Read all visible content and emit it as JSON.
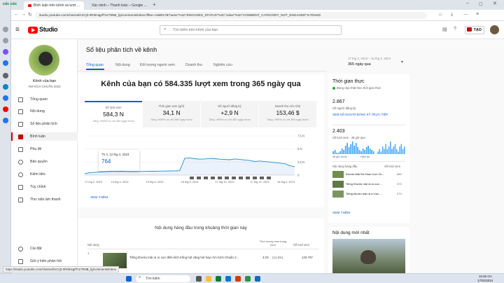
{
  "browser": {
    "brand": "cốc cốc",
    "tabs": [
      {
        "label": "Bình luận trên kênh và lượt ..."
      },
      {
        "label": "Xác minh – Thanh toán – Google ..."
      }
    ],
    "url": "studio.youtube.com/channel/UCrj3-0RI5HqpfTUr79NB_fg/comments/inbox?filter=%5B%7B\"name\"%3A\"ENGAGED_STATUS\"%2C\"value\"%3A\"COMMENT_CATEGORY_NOT_ENGAGED\"%7D%5D",
    "status_url": "https://studio.youtube.com/channel/UCrj3-0RI5HqpfTUr79NB_fg/comments/inbox"
  },
  "studio": {
    "logo": "Studio",
    "search_placeholder": "Tìm kiếm trên kênh của bạn",
    "create_label": "TẠO"
  },
  "channel": {
    "label": "Kênh của bạn",
    "name": "ÂM KÍCH CHUẨN 2023"
  },
  "nav": [
    {
      "label": "Tổng quan",
      "icon": "dashboard-icon",
      "active": false
    },
    {
      "label": "Nội dung",
      "icon": "content-icon",
      "active": false
    },
    {
      "label": "Số liệu phân tích",
      "icon": "analytics-icon",
      "active": false
    },
    {
      "label": "Bình luận",
      "icon": "comments-icon",
      "active": true
    },
    {
      "label": "Phụ đề",
      "icon": "subtitles-icon",
      "active": false
    },
    {
      "label": "Bản quyền",
      "icon": "copyright-icon",
      "active": false
    },
    {
      "label": "Kiếm tiền",
      "icon": "monetization-icon",
      "active": false
    },
    {
      "label": "Tùy chỉnh",
      "icon": "customization-icon",
      "active": false
    },
    {
      "label": "Thư viện âm thanh",
      "icon": "audio-library-icon",
      "active": false
    }
  ],
  "nav_bottom": [
    {
      "label": "Cài đặt",
      "icon": "settings-icon"
    },
    {
      "label": "Gửi ý kiến phản hồi",
      "icon": "feedback-icon"
    }
  ],
  "analytics": {
    "title": "Số liệu phân tích về kênh",
    "date_range": "17 thg 2, 2023 – 16 thg 2, 2024",
    "date_label": "365 ngày qua",
    "tabs": [
      "Tổng quan",
      "Nội dung",
      "Đối tượng người xem",
      "Doanh thu",
      "Nghiên cứu"
    ],
    "headline": "Kênh của bạn có 584.335 lượt xem trong 365 ngày qua",
    "metrics": [
      {
        "title": "Số lượt xem",
        "value": "584,3 N",
        "sub": "Tăng >999% so với 365 ngày trước"
      },
      {
        "title": "Thời gian xem (giờ)",
        "value": "34,1 N",
        "sub": "Tăng >999% so với 365 ngày trước"
      },
      {
        "title": "Số người đăng ký",
        "value": "+2,9 N",
        "sub": "Tăng >999% so với 365 ngày trước"
      },
      {
        "title": "Doanh thu ước tính",
        "value": "153,46 $",
        "sub": "Tăng >999% so với 365 ngày trước"
      }
    ],
    "see_more": "XEM THÊM",
    "top_content_title": "Nội dung hàng đầu trong khoảng thời gian này",
    "table_headers": [
      "Nội dung",
      "Thời lượng xem trung bình",
      "Số lượt xem"
    ],
    "table_row": {
      "title": "Tiếng khướu mái ra ro cực đỉnh kích trống hót căng hót hay! Âm Kích Chuẩn 2...",
      "duration": "4:23",
      "pct": "(14,5%)",
      "views": "123.707"
    }
  },
  "chart_data": {
    "type": "line",
    "title": "",
    "xlabel": "",
    "ylabel": "",
    "x_ticks": [
      "17 thg 2, 2023",
      "19 thg 4, 2023",
      "19 thg 6, 2023",
      "18 thg 8, 2023",
      "17 thg 10, 2023",
      "17 thg 12, 2023",
      "16 thg 2, 2024"
    ],
    "y_ticks": [
      "0",
      "2,5 N",
      "5 N",
      "7,5 N"
    ],
    "ylim": [
      0,
      7500
    ],
    "tooltip": {
      "date": "Th 4, 12 thg 4, 2023",
      "value": "764"
    },
    "series": [
      {
        "values": [
          300,
          450,
          520,
          600,
          650,
          720,
          764,
          740,
          720,
          700,
          690,
          700,
          720,
          730,
          740,
          760,
          780,
          800,
          820,
          840,
          3200,
          3300,
          3150,
          3050,
          3100,
          3200,
          3150,
          3050,
          3000,
          2950,
          3100,
          3000,
          2900,
          2800,
          2600,
          2700,
          2600,
          2500,
          2400,
          2300,
          2200,
          1800,
          1600
        ]
      }
    ],
    "grid": true
  },
  "realtime": {
    "title": "Thời gian thực",
    "status": "Đang cập nhật theo thời gian thực",
    "subs_value": "2.867",
    "subs_label": "Số người đăng ký",
    "live_link": "XEM SỐ NGƯỜI ĐĂNG KÝ TRỰC TIẾP",
    "views_value": "2.403",
    "views_label": "Số lượt xem · 48 giờ qua",
    "chart_left": "48 giờ trước",
    "chart_right": "Hiện tại",
    "top_header_left": "Nội dung hàng đầu",
    "top_header_right": "Số lượt xem",
    "top_items": [
      {
        "title": "Khướu Mái Ro Khan Cực Ch...",
        "views": "683"
      },
      {
        "title": "Tiếng Khướu mái ra ro cực ...",
        "views": "373"
      },
      {
        "title": "Tiếng khướu mái ra ro cực ...",
        "views": "273"
      }
    ],
    "see_more": "XEM THÊM",
    "latest_title": "Nội dung mới nhất",
    "spark_48h": [
      2,
      3,
      1,
      1,
      2,
      4,
      3,
      6,
      8,
      5,
      7,
      9,
      6,
      8,
      5,
      3,
      2,
      4,
      3,
      5,
      6,
      4,
      3,
      2
    ],
    "spark_60m": [
      1,
      2,
      1,
      3,
      2,
      4,
      2,
      3,
      5,
      2,
      3,
      4,
      2,
      1,
      3,
      4,
      2,
      3
    ]
  },
  "taskbar": {
    "search": "Tìm kiếm",
    "time": "10:45 CH",
    "date": "17/02/2024"
  }
}
